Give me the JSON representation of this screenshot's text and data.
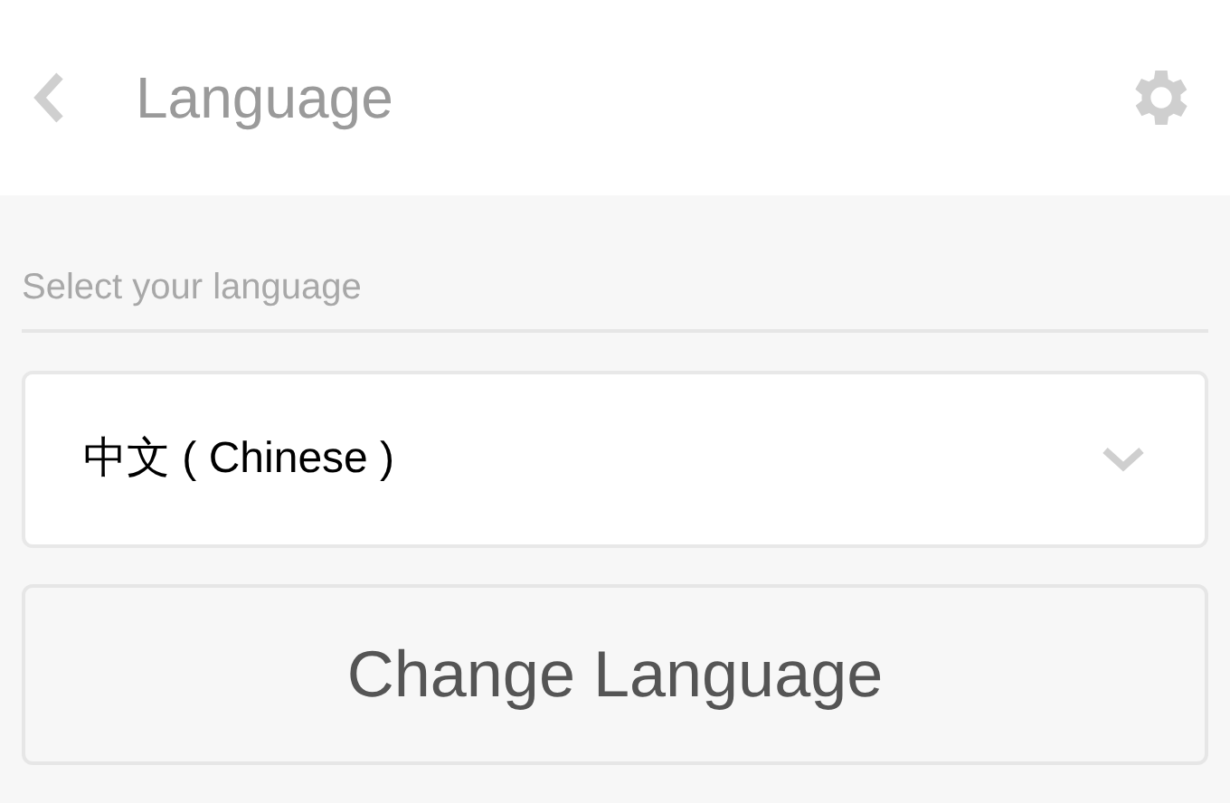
{
  "header": {
    "title": "Language"
  },
  "form": {
    "label": "Select your language",
    "select_value": "中文 ( Chinese )",
    "button": "Change Language"
  }
}
